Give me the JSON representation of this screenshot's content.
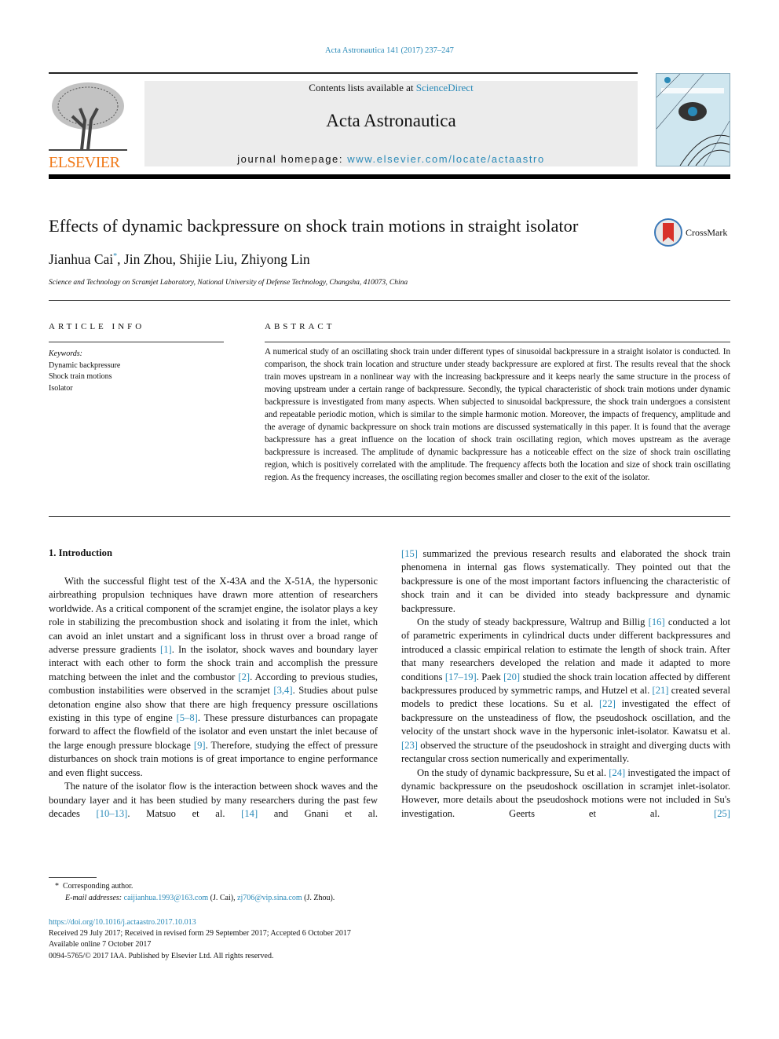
{
  "header": {
    "citation": "Acta Astronautica 141 (2017) 237–247",
    "contents_prefix": "Contents lists available at ",
    "contents_link": "ScienceDirect",
    "journal_title": "Acta Astronautica",
    "homepage_prefix": "journal homepage: ",
    "homepage_link": "www.elsevier.com/locate/actaastro",
    "publisher_logo": "ELSEVIER"
  },
  "article": {
    "title": "Effects of dynamic backpressure on shock train motions in straight isolator",
    "crossmark": "CrossMark",
    "authors": [
      "Jianhua Cai",
      "*",
      ", Jin Zhou, Shijie Liu, Zhiyong Lin"
    ],
    "affiliation": "Science and Technology on Scramjet Laboratory, National University of Defense Technology, Changsha, 410073, China"
  },
  "article_info": {
    "heading": "ARTICLE INFO",
    "keywords_label": "Keywords:",
    "keywords": [
      "Dynamic backpressure",
      "Shock train motions",
      "Isolator"
    ]
  },
  "abstract": {
    "heading": "ABSTRACT",
    "text": "A numerical study of an oscillating shock train under different types of sinusoidal backpressure in a straight isolator is conducted. In comparison, the shock train location and structure under steady backpressure are explored at first. The results reveal that the shock train moves upstream in a nonlinear way with the increasing backpressure and it keeps nearly the same structure in the process of moving upstream under a certain range of backpressure. Secondly, the typical characteristic of shock train motions under dynamic backpressure is investigated from many aspects. When subjected to sinusoidal backpressure, the shock train undergoes a consistent and repeatable periodic motion, which is similar to the simple harmonic motion. Moreover, the impacts of frequency, amplitude and the average of dynamic backpressure on shock train motions are discussed systematically in this paper. It is found that the average backpressure has a great influence on the location of shock train oscillating region, which moves upstream as the average backpressure is increased. The amplitude of dynamic backpressure has a noticeable effect on the size of shock train oscillating region, which is positively correlated with the amplitude. The frequency affects both the location and size of shock train oscillating region. As the frequency increases, the oscillating region becomes smaller and closer to the exit of the isolator."
  },
  "body": {
    "section_heading": "1.  Introduction",
    "left": [
      "With the successful flight test of the X-43A and the X-51A, the hypersonic airbreathing propulsion techniques have drawn more attention of researchers worldwide. As a critical component of the scramjet engine, the isolator plays a key role in stabilizing the precombustion shock and isolating it from the inlet, which can avoid an inlet unstart and a significant loss in thrust over a broad range of adverse pressure gradients [1]. In the isolator, shock waves and boundary layer interact with each other to form the shock train and accomplish the pressure matching between the inlet and the combustor [2]. According to previous studies, combustion instabilities were observed in the scramjet [3,4]. Studies about pulse detonation engine also show that there are high frequency pressure oscillations existing in this type of engine [5–8]. These pressure disturbances can propagate forward to affect the flowfield of the isolator and even unstart the inlet because of the large enough pressure blockage [9]. Therefore, studying the effect of pressure disturbances on shock train motions is of great importance to engine performance and even flight success.",
      "The nature of the isolator flow is the interaction between shock waves and the boundary layer and it has been studied by many researchers during the past few decades [10–13]. Matsuo et al. [14] and Gnani et al."
    ],
    "right": [
      "[15] summarized the previous research results and elaborated the shock train phenomena in internal gas flows systematically. They pointed out that the backpressure is one of the most important factors influencing the characteristic of shock train and it can be divided into steady backpressure and dynamic backpressure.",
      "On the study of steady backpressure, Waltrup and Billig [16] conducted a lot of parametric experiments in cylindrical ducts under different backpressures and introduced a classic empirical relation to estimate the length of shock train. After that many researchers developed the relation and made it adapted to more conditions [17–19]. Paek [20] studied the shock train location affected by different backpressures produced by symmetric ramps, and Hutzel et al. [21] created several models to predict these locations. Su et al. [22] investigated the effect of backpressure on the unsteadiness of flow, the pseudoshock oscillation, and the velocity of the unstart shock wave in the hypersonic inlet-isolator. Kawatsu et al. [23] observed the structure of the pseudoshock in straight and diverging ducts with rectangular cross section numerically and experimentally.",
      "On the study of dynamic backpressure, Su et al. [24] investigated the impact of dynamic backpressure on the pseudoshock oscillation in scramjet inlet-isolator. However, more details about the pseudoshock motions were not included in Su's investigation. Geerts et al. [25]"
    ]
  },
  "footnote": {
    "mark": "*",
    "corresponding": "Corresponding author.",
    "email_label": "E-mail addresses: ",
    "email1": "caijianhua.1993@163.com",
    "name1": " (J. Cai), ",
    "email2": "zj706@vip.sina.com",
    "name2": " (J. Zhou)."
  },
  "meta": {
    "doi": "https://doi.org/10.1016/j.actaastro.2017.10.013",
    "received": "Received 29 July 2017; Received in revised form 29 September 2017; Accepted 6 October 2017",
    "available": "Available online 7 October 2017",
    "copyright": "0094-5765/© 2017 IAA. Published by Elsevier Ltd. All rights reserved."
  },
  "colors": {
    "link": "#2a8ab8",
    "elsevier_orange": "#f07a1a",
    "banner_gray": "#ececec"
  }
}
